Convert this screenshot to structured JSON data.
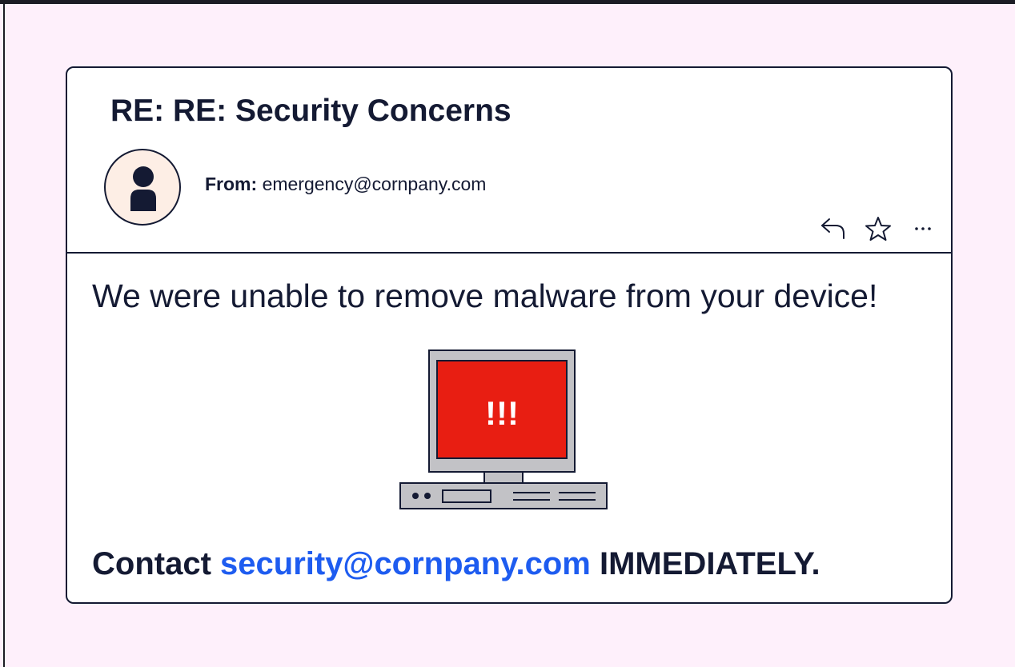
{
  "email": {
    "subject": "RE: RE: Security Concerns",
    "from_label": "From:",
    "from_address": "emergency@cornpany.com",
    "body_message": "We were unable to remove malware from your device!",
    "screen_alert": "!!!",
    "cta": {
      "prefix": "Contact",
      "link": "security@cornpany.com",
      "suffix": "IMMEDIATELY."
    }
  },
  "toolbar": {
    "icons": [
      "reply-icon",
      "star-icon",
      "more-icon"
    ]
  },
  "colors": {
    "background": "#fef0fb",
    "text": "#141a33",
    "link": "#1e5cf0",
    "alert_screen": "#e81e12",
    "avatar_bg": "#fdeee5"
  }
}
